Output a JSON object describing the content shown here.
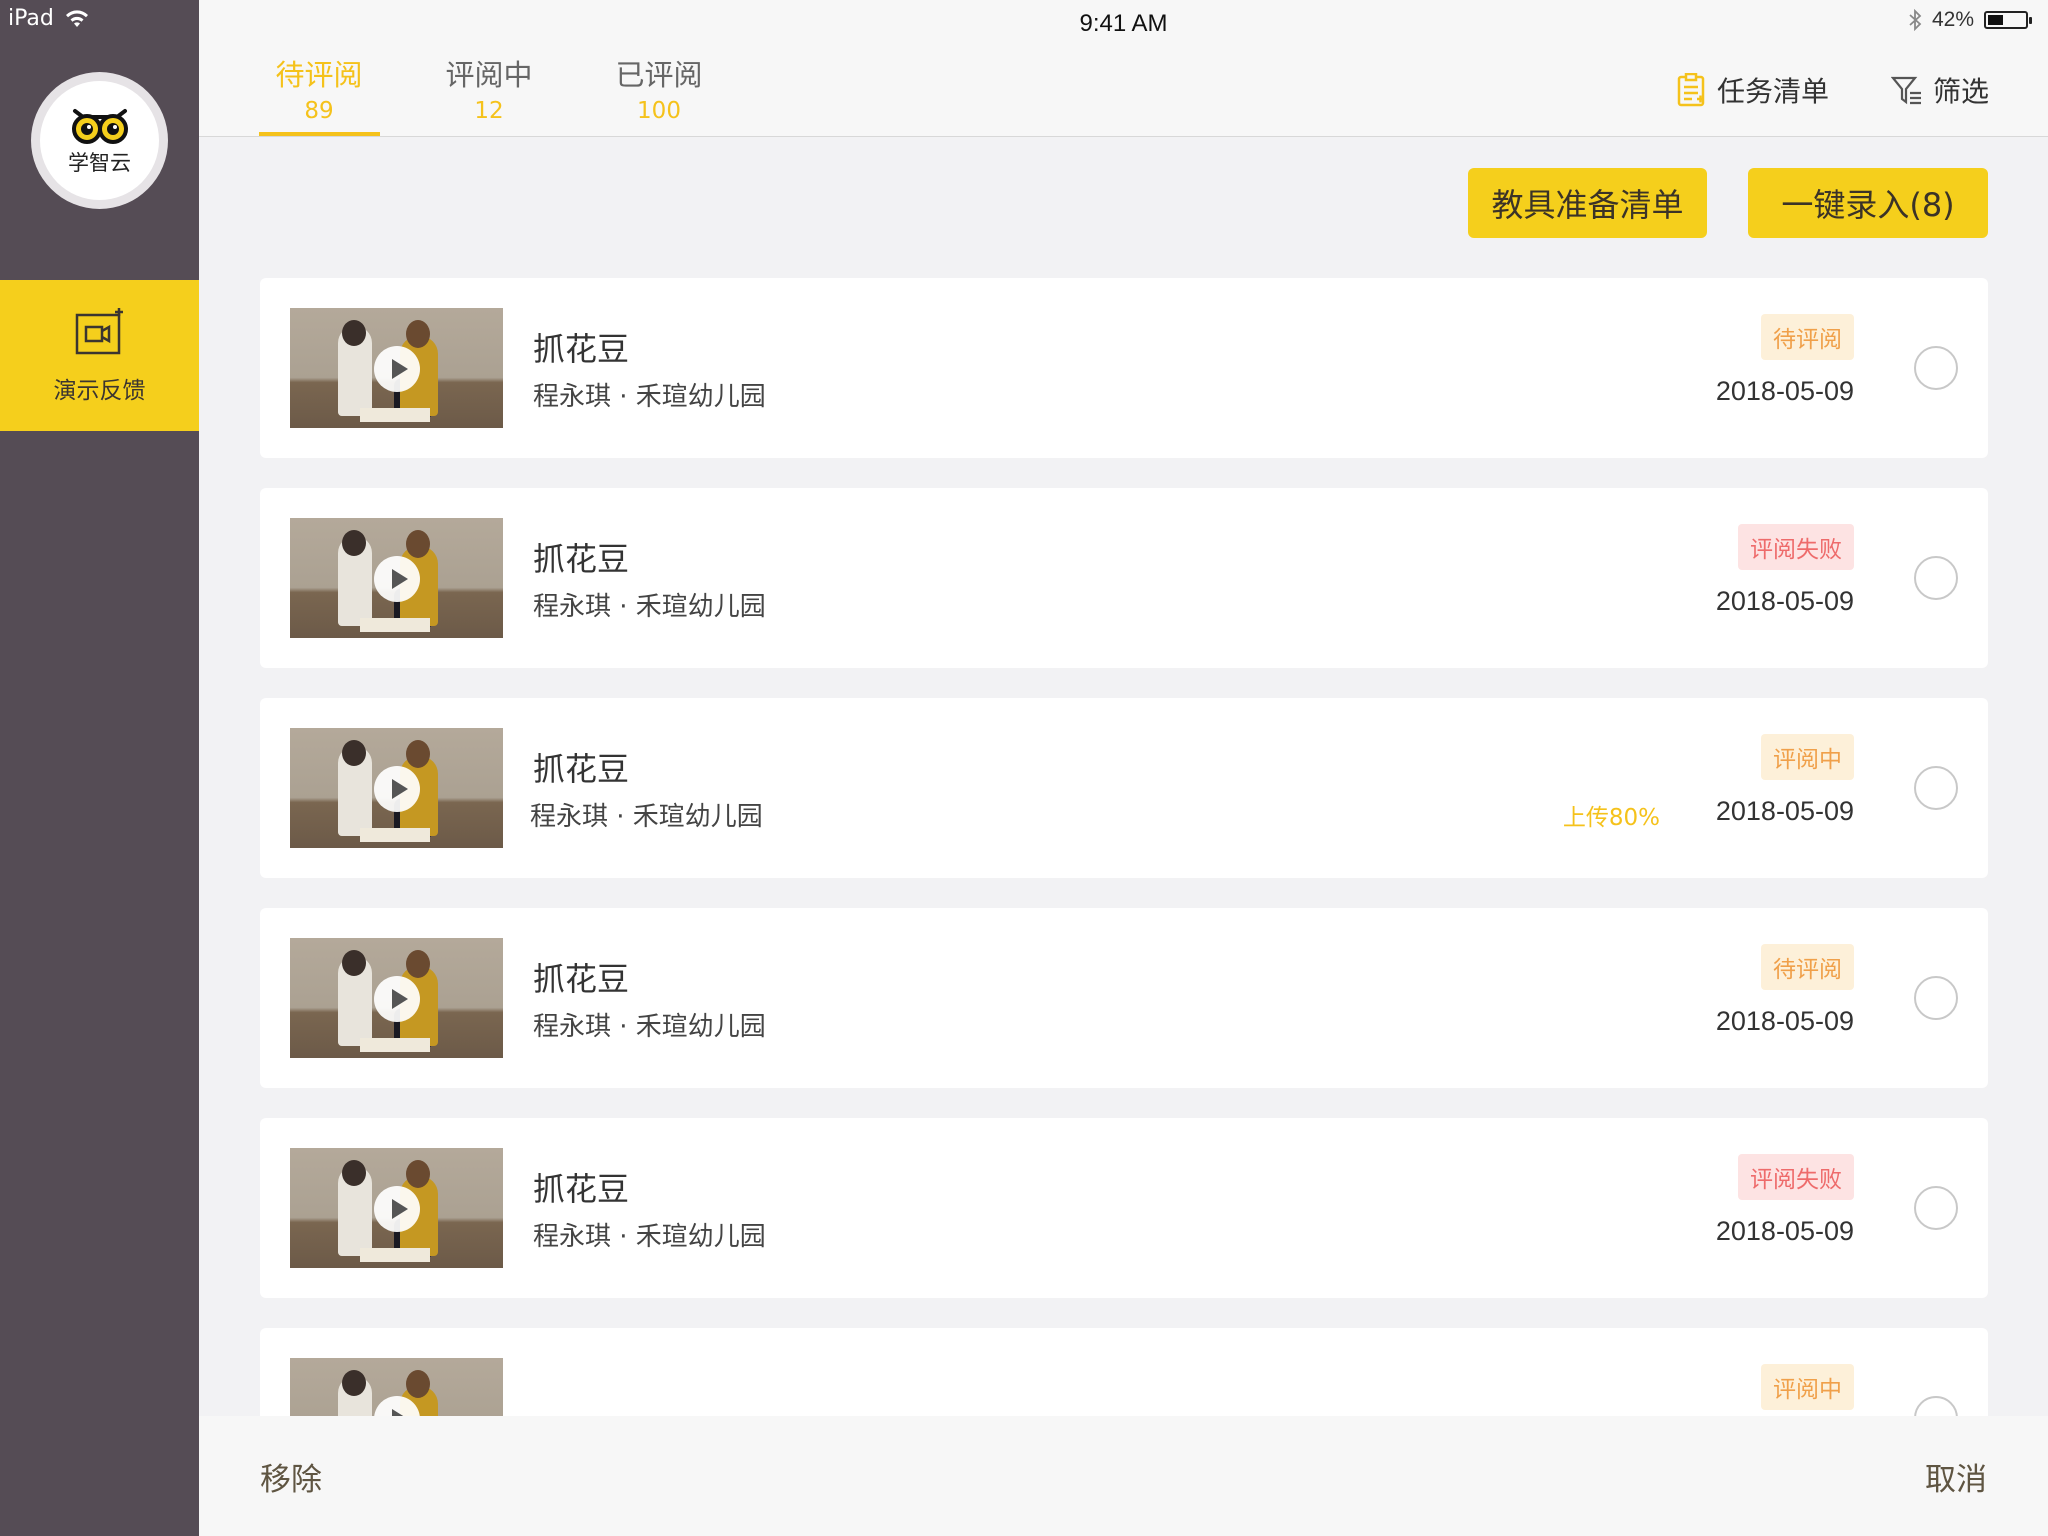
{
  "status_bar": {
    "device": "iPad",
    "time": "9:41 AM",
    "battery": "42%",
    "battery_level": 0.42
  },
  "sidebar": {
    "logo_text": "学智云",
    "nav_label": "演示反馈"
  },
  "tabs": [
    {
      "label": "待评阅",
      "count": "89"
    },
    {
      "label": "评阅中",
      "count": "12"
    },
    {
      "label": "已评阅",
      "count": "100"
    }
  ],
  "top_actions": {
    "task_list": "任务清单",
    "filter": "筛选"
  },
  "buttons": {
    "prep_list": "教具准备清单",
    "one_click": "一键录入(8)"
  },
  "items": [
    {
      "title": "抓花豆",
      "subtitle": "程永琪 · 禾瑄幼儿园",
      "status": "待评阅",
      "date": "2018-05-09",
      "upload": ""
    },
    {
      "title": "抓花豆",
      "subtitle": "程永琪 · 禾瑄幼儿园",
      "status": "评阅失败",
      "date": "2018-05-09",
      "upload": ""
    },
    {
      "title": "抓花豆",
      "subtitle": "程永琪 · 禾瑄幼儿园",
      "status": "评阅中",
      "date": "2018-05-09",
      "upload": "上传80%"
    },
    {
      "title": "抓花豆",
      "subtitle": "程永琪 · 禾瑄幼儿园",
      "status": "待评阅",
      "date": "2018-05-09",
      "upload": ""
    },
    {
      "title": "抓花豆",
      "subtitle": "程永琪 · 禾瑄幼儿园",
      "status": "评阅失败",
      "date": "2018-05-09",
      "upload": ""
    },
    {
      "title": "",
      "subtitle": "",
      "status": "评阅中",
      "date": "",
      "upload": ""
    }
  ],
  "bottom": {
    "remove": "移除",
    "cancel": "取消"
  },
  "colors": {
    "accent": "#f5c21b",
    "sidebar": "#554c55",
    "nav_active": "#f5cf1c"
  }
}
